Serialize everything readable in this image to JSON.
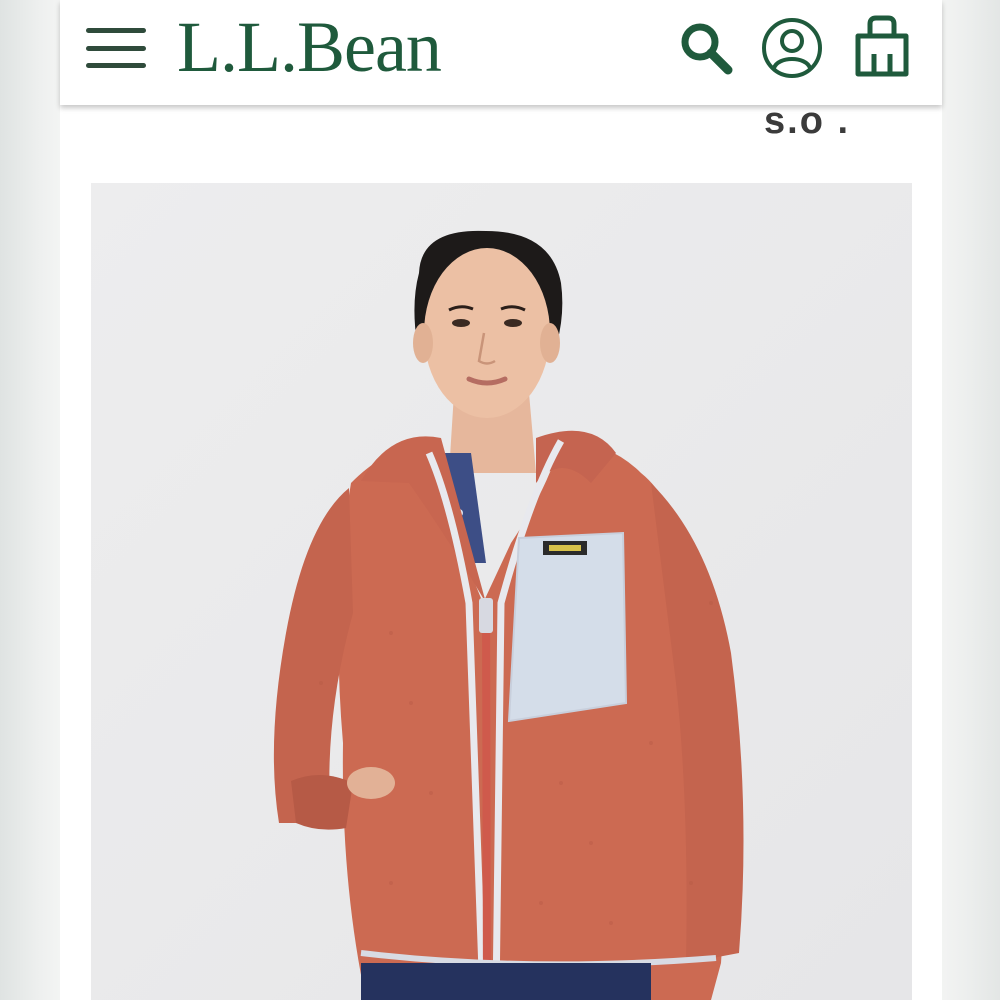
{
  "header": {
    "menu_icon": "hamburger-menu-icon",
    "logo_text": "L.L.Bean",
    "search_icon": "search-icon",
    "account_icon": "account-icon",
    "bag_icon": "shopping-bag-icon",
    "brand_color": "#1f5a3c"
  },
  "overlay_text": "s.o .",
  "product": {
    "image_icon": "product-photo-red-fleece-hoodie",
    "jacket_color": "#cc6a52",
    "pocket_color": "#d4dde9"
  }
}
